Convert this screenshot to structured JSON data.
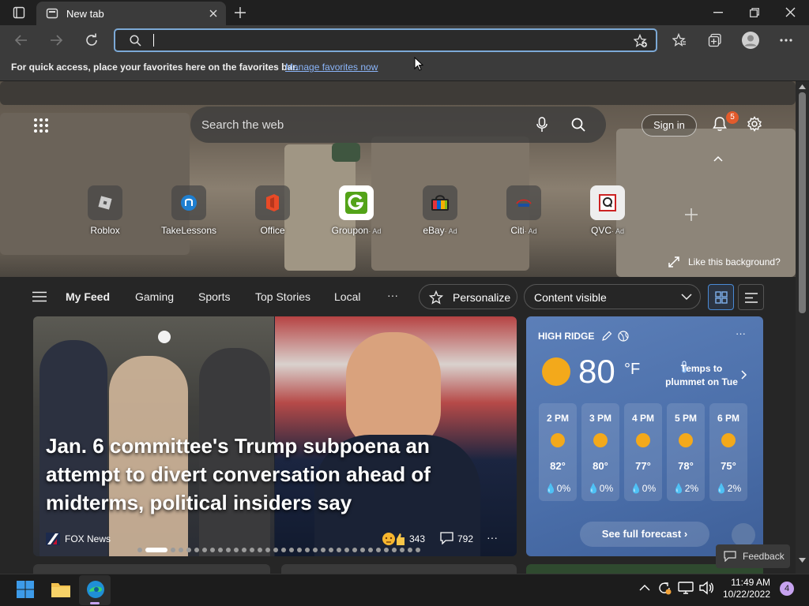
{
  "browser": {
    "tab_title": "New tab",
    "address_value": "",
    "favbar_message": "For quick access, place your favorites here on the favorites bar.",
    "favbar_link": "Manage favorites now"
  },
  "hero": {
    "search_placeholder": "Search the web",
    "signin_label": "Sign in",
    "notification_count": "5",
    "like_background": "Like this background?",
    "quick_links": [
      {
        "label": "Roblox",
        "ad": ""
      },
      {
        "label": "TakeLessons",
        "ad": ""
      },
      {
        "label": "Office",
        "ad": ""
      },
      {
        "label": "Groupon",
        "ad": "· Ad"
      },
      {
        "label": "eBay",
        "ad": "· Ad"
      },
      {
        "label": "Citi",
        "ad": "· Ad"
      },
      {
        "label": "QVC",
        "ad": "· Ad"
      }
    ]
  },
  "feed_nav": {
    "items": [
      "My Feed",
      "Gaming",
      "Sports",
      "Top Stories",
      "Local"
    ],
    "more": "···",
    "personalize": "Personalize",
    "content_visibility": "Content visible"
  },
  "news": {
    "headline": "Jan. 6 committee's Trump subpoena an attempt to divert conversation ahead of midterms, political insiders say",
    "source": "FOX News",
    "reactions": "343",
    "comments": "792",
    "slide_count": 34,
    "active_slide": 2
  },
  "weather": {
    "location": "HIGH RIDGE",
    "temperature": "80",
    "unit": "°F",
    "alert": "Temps to plummet on Tue",
    "hourly": [
      {
        "time": "2 PM",
        "temp": "82°",
        "precip": "0%"
      },
      {
        "time": "3 PM",
        "temp": "80°",
        "precip": "0%"
      },
      {
        "time": "4 PM",
        "temp": "77°",
        "precip": "0%"
      },
      {
        "time": "5 PM",
        "temp": "78°",
        "precip": "2%"
      },
      {
        "time": "6 PM",
        "temp": "75°",
        "precip": "2%"
      }
    ],
    "forecast_button": "See full forecast"
  },
  "feedback_label": "Feedback",
  "taskbar": {
    "time": "11:49 AM",
    "date": "10/22/2022",
    "notification_count": "4"
  }
}
